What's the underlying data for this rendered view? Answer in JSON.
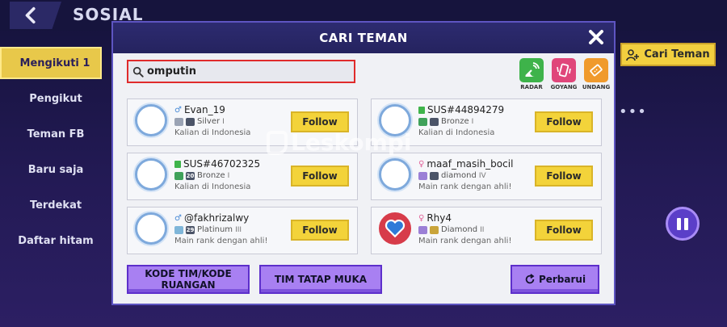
{
  "page": {
    "title": "SOSIAL"
  },
  "sidebar": {
    "items": [
      {
        "label": "Mengikuti 1",
        "active": true
      },
      {
        "label": "Pengikut",
        "active": false
      },
      {
        "label": "Teman FB",
        "active": false
      },
      {
        "label": "Baru saja",
        "active": false
      },
      {
        "label": "Terdekat",
        "active": false
      },
      {
        "label": "Daftar hitam",
        "active": false
      }
    ]
  },
  "header_right": {
    "cari_teman_label": "Cari Teman",
    "more_label": "•••"
  },
  "modal": {
    "title": "CARI TEMAN",
    "search": {
      "value": "omputin",
      "placeholder": ""
    },
    "tools": [
      {
        "label": "RADAR",
        "icon": "radar-icon"
      },
      {
        "label": "GOYANG",
        "icon": "shake-phone-icon"
      },
      {
        "label": "UNDANG",
        "icon": "ticket-icon"
      }
    ],
    "results": [
      {
        "name": "Evan_19",
        "gender": "male",
        "level": "",
        "rank": "Silver",
        "rank_tier": "I",
        "status": "Kalian di Indonesia",
        "follow_label": "Follow"
      },
      {
        "name": "SUS#44894279",
        "gender": "other",
        "level": "",
        "rank": "Bronze",
        "rank_tier": "I",
        "status": "Kalian di Indonesia",
        "follow_label": "Follow"
      },
      {
        "name": "SUS#46702325",
        "gender": "other",
        "level": "20",
        "rank": "Bronze",
        "rank_tier": "I",
        "status": "Kalian di Indonesia",
        "follow_label": "Follow"
      },
      {
        "name": "maaf_masih_bocil",
        "gender": "female",
        "level": "",
        "rank": "diamond",
        "rank_tier": "IV",
        "status": "Main rank dengan ahli!",
        "follow_label": "Follow"
      },
      {
        "name": "@fakhrizalwy",
        "gender": "male",
        "level": "29",
        "rank": "Platinum",
        "rank_tier": "III",
        "status": "Main rank dengan ahli!",
        "follow_label": "Follow"
      },
      {
        "name": "Rhy4",
        "gender": "female",
        "level": "",
        "rank": "Diamond",
        "rank_tier": "II",
        "status": "Main rank dengan ahli!",
        "follow_label": "Follow"
      }
    ],
    "buttons": {
      "team_code": "KODE TIM/KODE RUANGAN",
      "face_to_face": "TIM TATAP MUKA",
      "refresh": "Perbarui"
    }
  },
  "watermark": {
    "text": "Leskompi"
  },
  "colors": {
    "accent_yellow": "#f3d33a",
    "modal_header": "#2d2b70",
    "button_purple": "#a880f2",
    "search_border": "#e02b2b"
  }
}
